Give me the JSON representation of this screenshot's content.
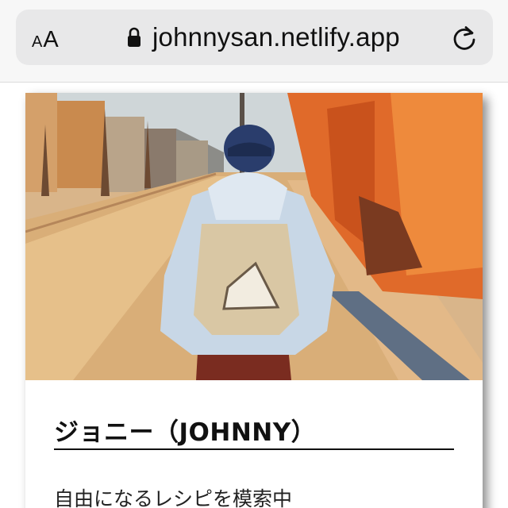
{
  "browser": {
    "text_size_small": "A",
    "text_size_large": "A",
    "url": "johnnysan.netlify.app",
    "icons": {
      "lock": "lock-icon",
      "reload": "reload-icon"
    }
  },
  "profile": {
    "name": "ジョニー（JOHNNY）",
    "tagline": "自由になるレシピを模索中"
  },
  "colors": {
    "address_bar_bg": "#e8e8e9",
    "text": "#111111",
    "card_bg": "#ffffff"
  }
}
